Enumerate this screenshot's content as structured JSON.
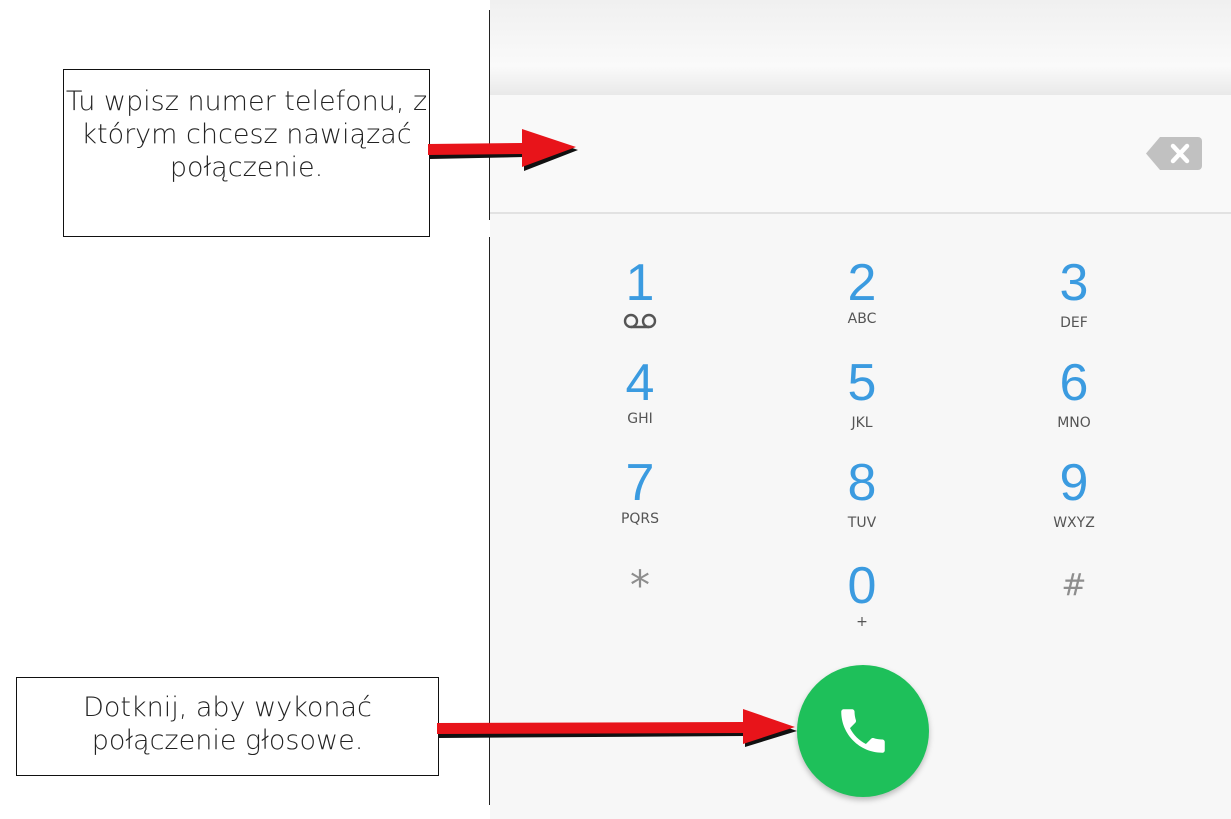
{
  "annotations": {
    "number_hint": "Tu wpisz numer telefonu, z którym chcesz nawiązać połączenie.",
    "call_hint": "Dotknij, aby wykonać połączenie głosowe."
  },
  "dialer": {
    "number_value": "",
    "keys": [
      {
        "digit": "1",
        "letters": "",
        "icon": "voicemail-icon"
      },
      {
        "digit": "2",
        "letters": "ABC"
      },
      {
        "digit": "3",
        "letters": "DEF"
      },
      {
        "digit": "4",
        "letters": "GHI"
      },
      {
        "digit": "5",
        "letters": "JKL"
      },
      {
        "digit": "6",
        "letters": "MNO"
      },
      {
        "digit": "7",
        "letters": "PQRS"
      },
      {
        "digit": "8",
        "letters": "TUV"
      },
      {
        "digit": "9",
        "letters": "WXYZ"
      },
      {
        "digit": "*",
        "letters": ""
      },
      {
        "digit": "0",
        "letters": "+"
      },
      {
        "digit": "#",
        "letters": ""
      }
    ],
    "backspace_icon": "backspace-icon",
    "call_icon": "phone-icon"
  },
  "colors": {
    "digit": "#3b9be0",
    "call_button": "#1ec05a",
    "arrow": "#e8141a"
  }
}
